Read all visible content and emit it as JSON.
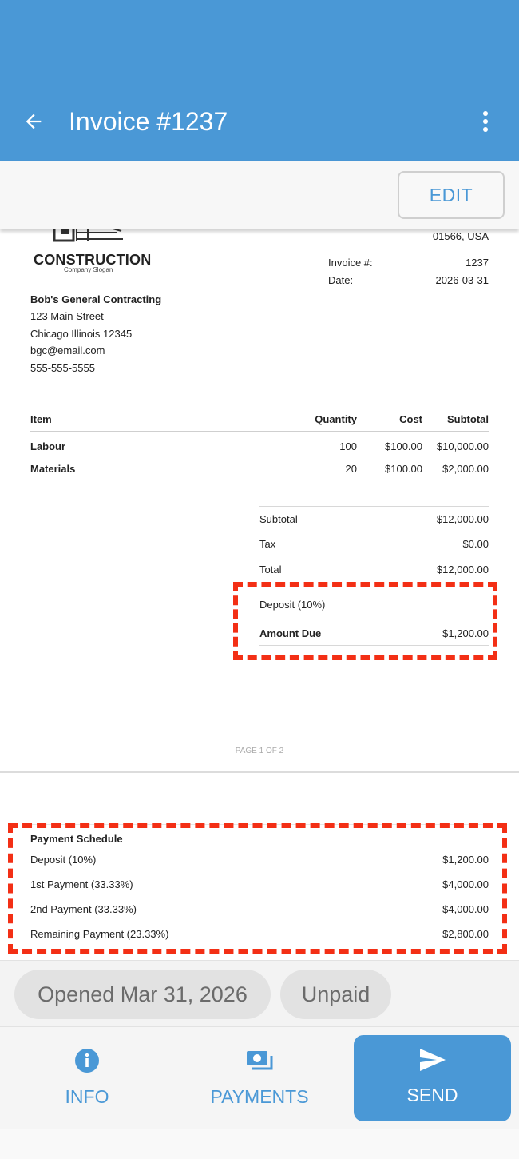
{
  "app_bar": {
    "title": "Invoice #1237",
    "back_icon": "arrow-back-icon",
    "menu_icon": "more-vert-icon"
  },
  "toolbar": {
    "edit_label": "EDIT"
  },
  "invoice": {
    "logo": {
      "name": "CONSTRUCTION",
      "slogan": "Company Slogan"
    },
    "recipient_partial": "01566, USA",
    "meta": {
      "invoice_label": "Invoice #:",
      "invoice_value": "1237",
      "date_label": "Date:",
      "date_value": "2026-03-31"
    },
    "sender": {
      "name": "Bob's General Contracting",
      "street": "123 Main Street",
      "city": "Chicago Illinois 12345",
      "email": "bgc@email.com",
      "phone": "555-555-5555"
    },
    "table": {
      "headers": {
        "item": "Item",
        "quantity": "Quantity",
        "cost": "Cost",
        "subtotal": "Subtotal"
      },
      "rows": [
        {
          "item": "Labour",
          "quantity": "100",
          "cost": "$100.00",
          "subtotal": "$10,000.00"
        },
        {
          "item": "Materials",
          "quantity": "20",
          "cost": "$100.00",
          "subtotal": "$2,000.00"
        }
      ]
    },
    "totals": {
      "subtotal_label": "Subtotal",
      "subtotal_value": "$12,000.00",
      "tax_label": "Tax",
      "tax_value": "$0.00",
      "total_label": "Total",
      "total_value": "$12,000.00",
      "deposit_label": "Deposit (10%)",
      "amount_due_label": "Amount Due",
      "amount_due_value": "$1,200.00"
    },
    "page_indicator": "PAGE 1 OF 2"
  },
  "payment_schedule": {
    "title": "Payment Schedule",
    "items": [
      {
        "label": "Deposit (10%)",
        "amount": "$1,200.00"
      },
      {
        "label": "1st Payment (33.33%)",
        "amount": "$4,000.00"
      },
      {
        "label": "2nd Payment (33.33%)",
        "amount": "$4,000.00"
      },
      {
        "label": "Remaining Payment (23.33%)",
        "amount": "$2,800.00"
      }
    ]
  },
  "status_chips": {
    "opened": "Opened Mar 31, 2026",
    "payment_status": "Unpaid"
  },
  "bottom_nav": {
    "info": {
      "label": "INFO",
      "icon": "info-icon"
    },
    "payments": {
      "label": "PAYMENTS",
      "icon": "payments-icon"
    },
    "send": {
      "label": "SEND",
      "icon": "send-icon"
    }
  },
  "colors": {
    "primary": "#4a98d6",
    "highlight": "#f32f15",
    "chip_bg": "#e2e2e2"
  }
}
